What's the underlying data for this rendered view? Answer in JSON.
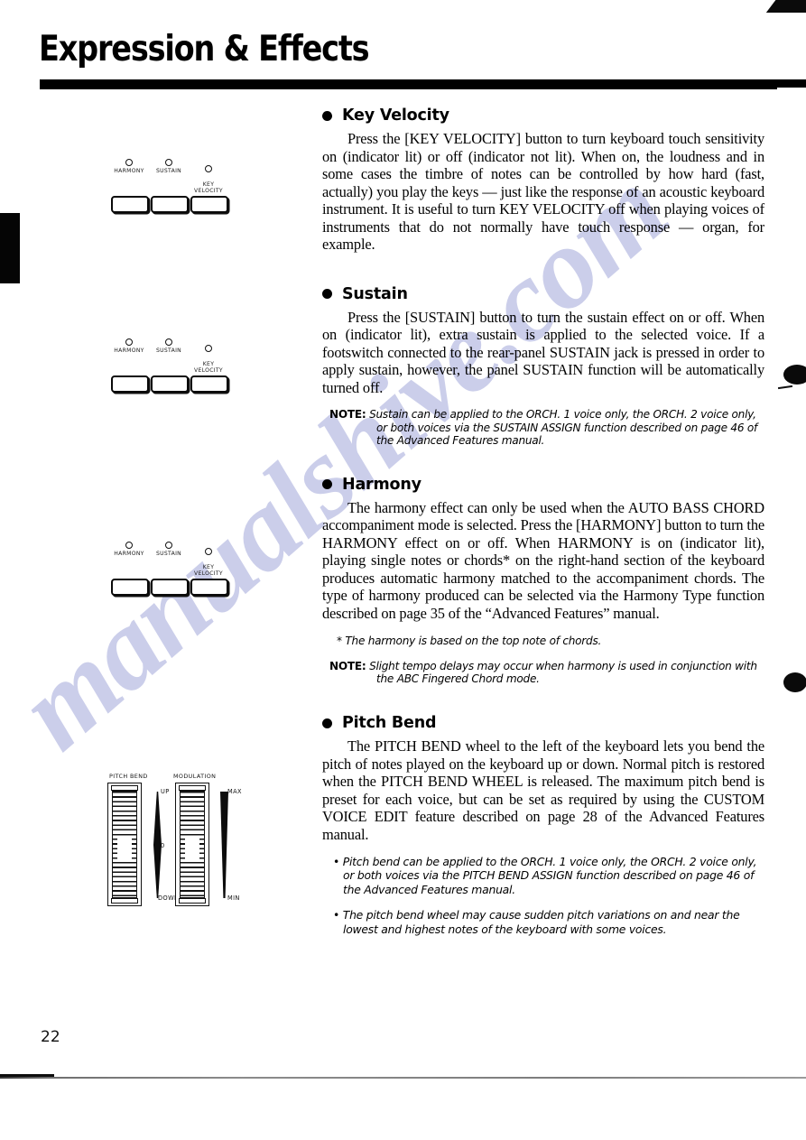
{
  "page": {
    "title": "Expression & Effects",
    "number": "22"
  },
  "watermark": {
    "text": "manualshive.com",
    "color": "#c9cce9"
  },
  "panel_figure": {
    "leds": [
      {
        "label": "HARMONY"
      },
      {
        "label": "SUSTAIN"
      },
      {
        "label": "KEY\nVELOCITY"
      }
    ]
  },
  "wheels_figure": {
    "pitch_bend": {
      "label": "PITCH BEND",
      "ticks": [
        "UP",
        "0",
        "DOWN"
      ]
    },
    "modulation": {
      "label": "MODULATION",
      "ticks": [
        "MAX",
        "MIN"
      ]
    }
  },
  "sections": [
    {
      "heading": "Key Velocity",
      "body": "Press the [KEY VELOCITY] button to turn keyboard touch sensitivity on (indicator lit) or off (indicator not lit). When on, the loudness and in some cases the timbre of notes can be controlled by how hard (fast, actually) you play the keys — just like the response of an acoustic keyboard instrument. It is useful to turn KEY VELOCITY off when playing voices of instruments that do not normally have touch response — organ, for example."
    },
    {
      "heading": "Sustain",
      "body": "Press the [SUSTAIN] button to turn the sustain effect on or off. When on (indicator lit), extra sustain is applied to the selected voice. If a footswitch connected to the rear-panel SUSTAIN jack is pressed in order to apply sustain, however, the panel SUSTAIN function will be automatically turned off.",
      "note_label": "NOTE:",
      "note_text": " Sustain can be applied to the ORCH. 1 voice only, the ORCH. 2 voice only, or both voices via the SUSTAIN ASSIGN function described on page 46 of the Advanced Features manual."
    },
    {
      "heading": "Harmony",
      "body": "The harmony effect can only be used when the AUTO BASS CHORD accompaniment mode is selected. Press the [HARMONY] button to turn the HARMONY effect on or off. When HARMONY is on (indicator lit), playing single notes or chords* on the right-hand section of the keyboard produces automatic harmony matched to the accompaniment chords. The type of harmony produced can be selected via the Harmony Type function described on page 35 of the “Advanced Features” manual.",
      "footnote": "* The harmony is based on the top note of chords.",
      "note_label": "NOTE:",
      "note_text": " Slight tempo delays may occur when harmony is used in conjunction with the ABC Fingered Chord mode."
    },
    {
      "heading": "Pitch Bend",
      "body": "The PITCH BEND wheel to the left of the keyboard lets you bend the pitch of notes played on the keyboard up or down. Normal pitch is restored when the PITCH BEND WHEEL is released. The maximum pitch bend is preset for each voice, but can be set as required by using the CUSTOM VOICE EDIT feature described on page 28 of the Advanced Features manual.",
      "bullets": [
        "• Pitch bend can be applied to the ORCH. 1 voice only, the ORCH. 2 voice only, or both voices via the PITCH BEND ASSIGN function described on page 46 of the Advanced Features manual.",
        "• The pitch bend wheel may cause sudden pitch variations on and near the lowest and highest notes of the keyboard with some voices."
      ]
    }
  ]
}
